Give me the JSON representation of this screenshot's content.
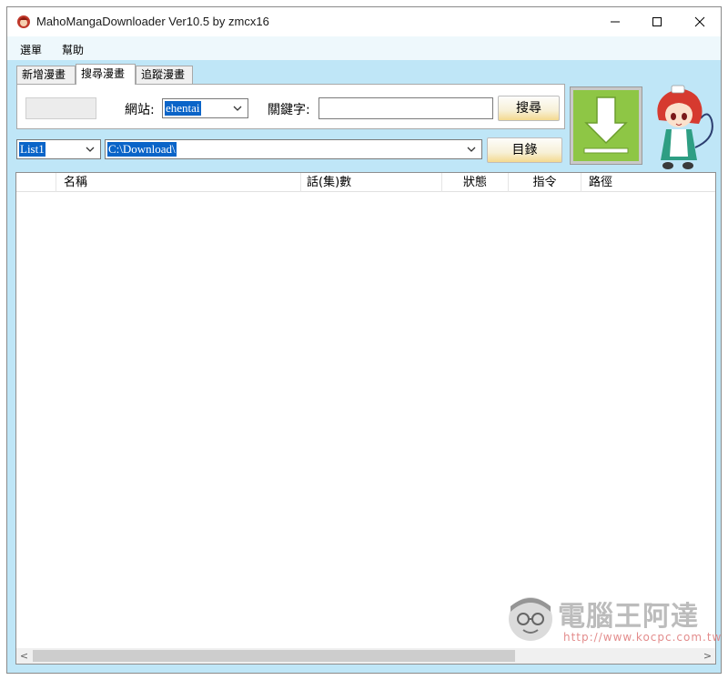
{
  "window": {
    "title": "MahoMangaDownloader Ver10.5 by zmcx16",
    "controls": {
      "minimize": "—",
      "maximize": "☐",
      "close": "✕"
    }
  },
  "menu": {
    "items": [
      "選單",
      "幫助"
    ]
  },
  "tabs": [
    {
      "label": "新增漫畫",
      "active": false
    },
    {
      "label": "搜尋漫畫",
      "active": true
    },
    {
      "label": "追蹤漫畫",
      "active": false
    }
  ],
  "search": {
    "site_label": "網站:",
    "site_value": "ehentai",
    "keyword_label": "關鍵字:",
    "keyword_value": "",
    "search_button": "搜尋"
  },
  "path": {
    "list_value": "List1",
    "dir_value": "C:\\Download\\",
    "dir_button": "目錄"
  },
  "table": {
    "columns": [
      "",
      "名稱",
      "話(集)數",
      "狀態",
      "指令",
      "路徑"
    ],
    "rows": []
  },
  "watermark": {
    "text": "電腦王阿達",
    "url": "http://www.kocpc.com.tw"
  },
  "scroll": {
    "left_arrow": "<",
    "right_arrow": ">"
  },
  "colors": {
    "window_bg": "#bfe6f7",
    "selection": "#0a64c8",
    "download_green": "#8ec645"
  }
}
